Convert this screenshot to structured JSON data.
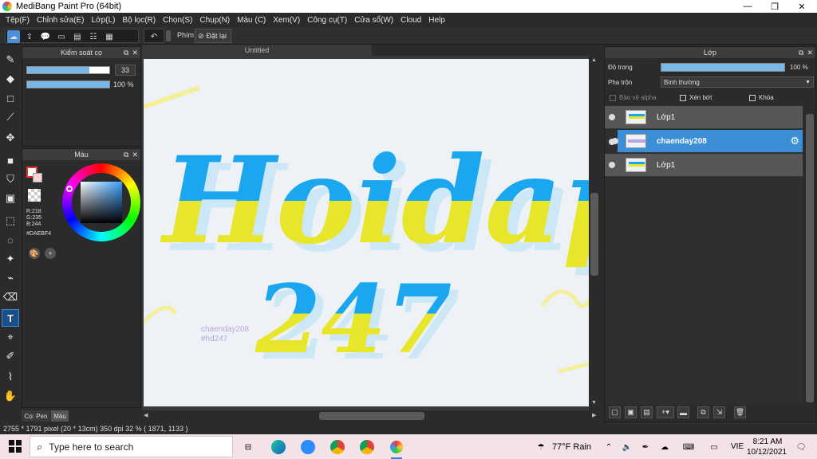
{
  "window": {
    "title": "MediBang Paint Pro (64bit)",
    "minimize": "—",
    "maximize": "❐",
    "close": "✕"
  },
  "menu": [
    "Tệp(F)",
    "Chỉnh sửa(E)",
    "Lớp(L)",
    "Bộ lọc(R)",
    "Chọn(S)",
    "Chụp(N)",
    "Màu (C)",
    "Xem(V)",
    "Công cụ(T)",
    "Cửa sổ(W)",
    "Cloud",
    "Help"
  ],
  "toolbar": {
    "shortcut_label": "Phím",
    "reset_label": "Đặt lại"
  },
  "brush_panel": {
    "title": "Kiểm soát cọ",
    "size_value": "33",
    "size_fill": 0.76,
    "opacity_value": "100 %",
    "opacity_fill": 1.0
  },
  "color_panel": {
    "title": "Màu",
    "r": "R:218",
    "g": "G:235",
    "b": "B:244",
    "hex": "#DAEBF4",
    "fg_color": "#DAEBF4"
  },
  "left_tabs": {
    "brush_tab": "Cọ: Pen",
    "color_tab": "Màu"
  },
  "document": {
    "tab_title": "Untitled",
    "artwork": {
      "word1": "Hoidap",
      "word2": "247",
      "watermark_line1": "chaenday208",
      "watermark_line2": "#hd247",
      "top_color": "#1aa7f0",
      "bottom_color": "#e8e62a",
      "background": "#eef2f6"
    }
  },
  "layers_panel": {
    "title": "Lớp",
    "opacity_label": "Độ trong",
    "opacity_value": "100 %",
    "blend_label": "Pha trộn",
    "blend_value": "Bình thường",
    "protect_alpha": "Bảo vệ alpha",
    "clipping": "Xén bớt",
    "lock": "Khóa",
    "layers": [
      {
        "name": "Lớp1",
        "selected": false
      },
      {
        "name": "chaenday208",
        "selected": true
      },
      {
        "name": "Lớp1",
        "selected": false
      }
    ]
  },
  "status": {
    "text": "2755 * 1791 pixel   (20 * 13cm)   350 dpi   32 %   ( 1871, 1133 )"
  },
  "taskbar": {
    "search_placeholder": "Type here to search",
    "weather": "77°F  Rain",
    "language": "VIE",
    "time": "8:21 AM",
    "date": "10/12/2021"
  }
}
